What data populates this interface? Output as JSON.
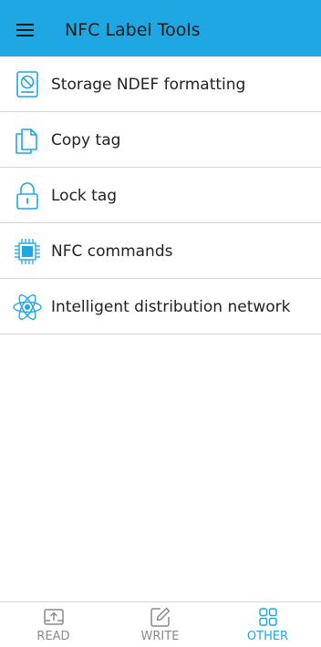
{
  "colors": {
    "app_bar": "#1ea7e3",
    "accent": "#1ea7e3",
    "inactive": "#8a8a8a",
    "divider": "#d6d6d6"
  },
  "header": {
    "title": "NFC Label Tools",
    "menu_icon": "hamburger-menu-icon"
  },
  "list": {
    "items": [
      {
        "label": "Storage NDEF formatting",
        "icon": "storage-format-icon"
      },
      {
        "label": "Copy tag",
        "icon": "copy-documents-icon"
      },
      {
        "label": "Lock tag",
        "icon": "lock-icon"
      },
      {
        "label": "NFC commands",
        "icon": "chip-icon"
      },
      {
        "label": "Intelligent distribution network",
        "icon": "atom-icon"
      }
    ]
  },
  "bottom_nav": {
    "items": [
      {
        "label": "READ",
        "icon": "read-tray-icon",
        "active": false
      },
      {
        "label": "WRITE",
        "icon": "write-pencil-icon",
        "active": false
      },
      {
        "label": "OTHER",
        "icon": "grid-apps-icon",
        "active": true
      }
    ]
  }
}
